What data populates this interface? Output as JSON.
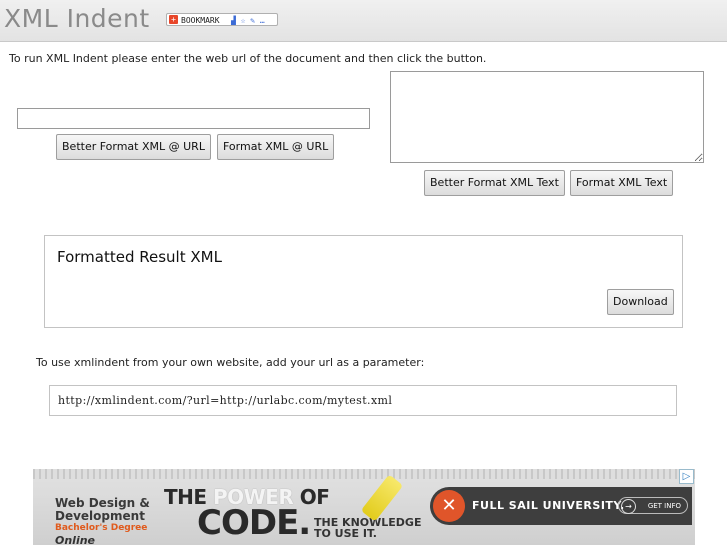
{
  "header": {
    "title": "XML Indent",
    "bookmark_label": "BOOKMARK",
    "bookmark_icons": "▟ ☆ ✎ …"
  },
  "form": {
    "intro_text": "To run XML Indent please enter the web url of the document and then click the button.",
    "url_input_value": "",
    "better_format_url_label": "Better Format XML @ URL",
    "format_url_label": "Format XML @ URL",
    "textarea_value": "",
    "better_format_text_label": "Better Format XML Text",
    "format_text_label": "Format XML Text"
  },
  "result": {
    "title": "Formatted Result XML",
    "download_label": "Download"
  },
  "usage": {
    "text": "To use xmlindent from your own website, add your url as a parameter:",
    "example_url": "http://xmlindent.com/?url=http://urlabc.com/mytest.xml"
  },
  "ad": {
    "left_line1": "Web Design &",
    "left_line2": "Development",
    "left_line3": "Bachelor's Degree",
    "left_line4": "Online",
    "headline_part1": "THE ",
    "headline_part2": "POWER",
    "headline_part3": " OF",
    "headline_code": "CODE.",
    "tagline_line1": "THE KNOWLEDGE",
    "tagline_line2": "TO USE IT.",
    "brand": "FULL SAIL UNIVERSITY.",
    "cta": "GET INFO",
    "adchoices_icon": "▷"
  },
  "colors": {
    "title_gray": "#8a8a8a",
    "ad_orange": "#e05a1c"
  }
}
